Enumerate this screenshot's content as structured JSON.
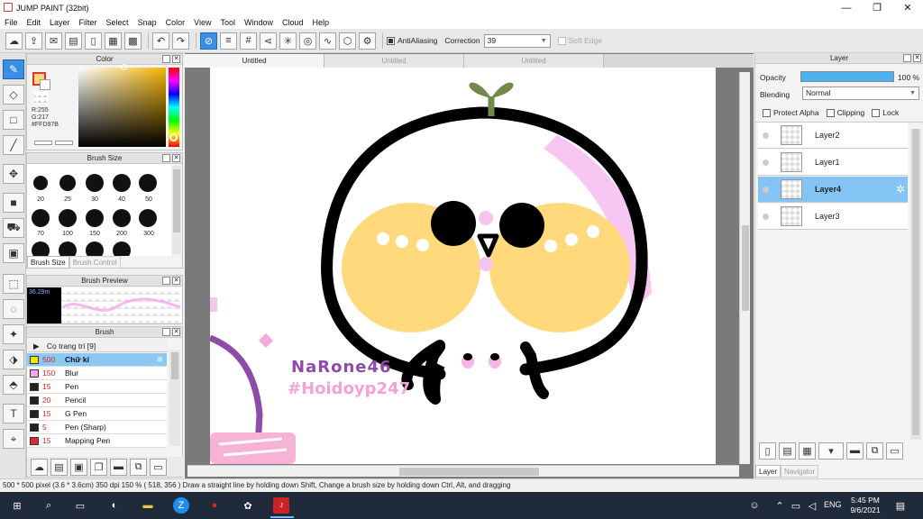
{
  "window": {
    "title": "JUMP PAINT (32bit)",
    "min": "—",
    "max": "❐",
    "close": "✕"
  },
  "menu": [
    "File",
    "Edit",
    "Layer",
    "Filter",
    "Select",
    "Snap",
    "Color",
    "View",
    "Tool",
    "Window",
    "Cloud",
    "Help"
  ],
  "toolbar": {
    "antialias_label": "AntiAliasing",
    "correction_label": "Correction",
    "correction_value": "39",
    "softedge_label": "Soft Edge"
  },
  "color_panel": {
    "title": "Color",
    "r": "R:255",
    "g": "G:217",
    "hex": "#FFD97B",
    "fg": "#FFD97B"
  },
  "brush_size_panel": {
    "title": "Brush Size",
    "sizes": [
      "20",
      "25",
      "30",
      "40",
      "50",
      "70",
      "100",
      "150",
      "200",
      "300"
    ],
    "tab_active": "Brush Size",
    "tab_inactive": "Brush Control"
  },
  "brush_preview_panel": {
    "title": "Brush Preview",
    "size_label": "36.29m"
  },
  "brush_panel": {
    "title": "Brush",
    "group": "Cọ trang trí [9]",
    "items": [
      {
        "size": "500",
        "name": "Chữ kí",
        "color": "#f4e400",
        "selected": true
      },
      {
        "size": "150",
        "name": "Blur",
        "color": "#f5a6f0",
        "selected": false
      },
      {
        "size": "15",
        "name": "Pen",
        "color": "#222222",
        "selected": false
      },
      {
        "size": "20",
        "name": "Pencil",
        "color": "#222222",
        "selected": false
      },
      {
        "size": "15",
        "name": "G Pen",
        "color": "#222222",
        "selected": false
      },
      {
        "size": "5",
        "name": "Pen (Sharp)",
        "color": "#222222",
        "selected": false
      },
      {
        "size": "15",
        "name": "Mapping Pen",
        "color": "#e02a2a",
        "selected": false
      }
    ]
  },
  "tabs": [
    "Untitled",
    "Untitled",
    "Untitled"
  ],
  "canvas": {
    "sig_name": "NaRone46",
    "sig_tag": "#Hoidoyp247"
  },
  "layer_panel": {
    "title": "Layer",
    "opacity_label": "Opacity",
    "opacity_value": "100 %",
    "opacity": 1.0,
    "blending_label": "Blending",
    "blending_value": "Normal",
    "protect_alpha": "Protect Alpha",
    "clipping": "Clipping",
    "lock": "Lock",
    "layers": [
      {
        "name": "Layer2",
        "selected": false
      },
      {
        "name": "Layer1",
        "selected": false
      },
      {
        "name": "Layer4",
        "selected": true
      },
      {
        "name": "Layer3",
        "selected": false
      }
    ],
    "tab_active": "Layer",
    "tab_inactive": "Navigator"
  },
  "status": {
    "text": "500 * 500 pixel   (3.6 * 3.6cm)   350 dpi   150 %   ( 518, 356 )   Draw a straight line by holding down Shift, Change a brush size by holding down Ctrl, Alt, and dragging"
  },
  "taskbar": {
    "lang": "ENG",
    "time": "5:45 PM",
    "date": "9/6/2021"
  }
}
